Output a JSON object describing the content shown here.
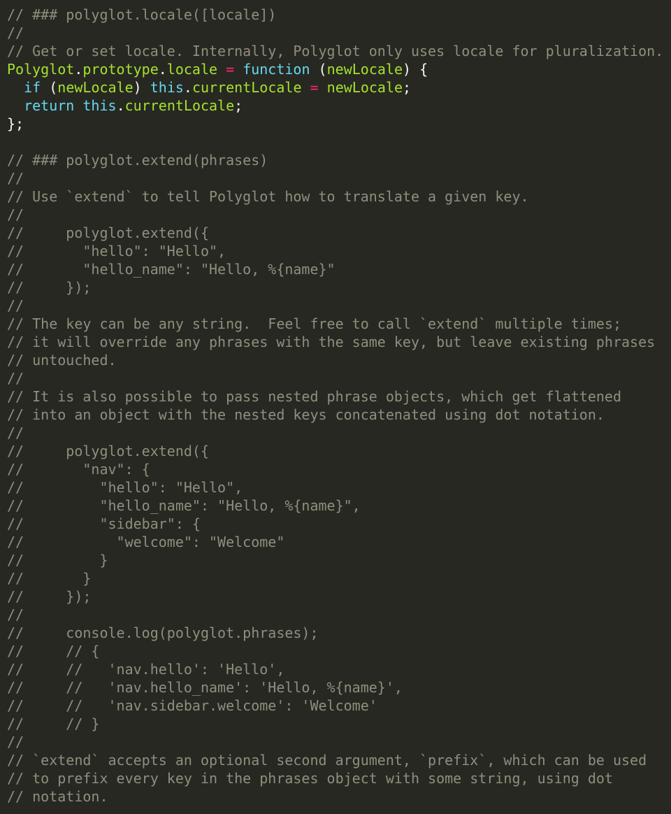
{
  "editor": {
    "language": "javascript",
    "theme_colors": {
      "background": "#272822",
      "comment": "#908e7d",
      "plain": "#f8f8f2",
      "name": "#a6e22e",
      "keyword": "#66d9ef",
      "operator": "#f92672"
    },
    "lines": [
      [
        {
          "t": "comment",
          "v": "// ### polyglot.locale([locale])"
        }
      ],
      [
        {
          "t": "comment",
          "v": "//"
        }
      ],
      [
        {
          "t": "comment",
          "v": "// Get or set locale. Internally, Polyglot only uses locale for pluralization."
        }
      ],
      [
        {
          "t": "name",
          "v": "Polyglot"
        },
        {
          "t": "plain",
          "v": "."
        },
        {
          "t": "name",
          "v": "prototype"
        },
        {
          "t": "plain",
          "v": "."
        },
        {
          "t": "name",
          "v": "locale"
        },
        {
          "t": "plain",
          "v": " "
        },
        {
          "t": "op",
          "v": "="
        },
        {
          "t": "plain",
          "v": " "
        },
        {
          "t": "kw",
          "v": "function"
        },
        {
          "t": "plain",
          "v": " ("
        },
        {
          "t": "name",
          "v": "newLocale"
        },
        {
          "t": "plain",
          "v": ") {"
        }
      ],
      [
        {
          "t": "plain",
          "v": "  "
        },
        {
          "t": "kw",
          "v": "if"
        },
        {
          "t": "plain",
          "v": " ("
        },
        {
          "t": "name",
          "v": "newLocale"
        },
        {
          "t": "plain",
          "v": ") "
        },
        {
          "t": "kw",
          "v": "this"
        },
        {
          "t": "plain",
          "v": "."
        },
        {
          "t": "name",
          "v": "currentLocale"
        },
        {
          "t": "plain",
          "v": " "
        },
        {
          "t": "op",
          "v": "="
        },
        {
          "t": "plain",
          "v": " "
        },
        {
          "t": "name",
          "v": "newLocale"
        },
        {
          "t": "plain",
          "v": ";"
        }
      ],
      [
        {
          "t": "plain",
          "v": "  "
        },
        {
          "t": "kw",
          "v": "return"
        },
        {
          "t": "plain",
          "v": " "
        },
        {
          "t": "kw",
          "v": "this"
        },
        {
          "t": "plain",
          "v": "."
        },
        {
          "t": "name",
          "v": "currentLocale"
        },
        {
          "t": "plain",
          "v": ";"
        }
      ],
      [
        {
          "t": "plain",
          "v": "};"
        }
      ],
      [
        {
          "t": "plain",
          "v": ""
        }
      ],
      [
        {
          "t": "comment",
          "v": "// ### polyglot.extend(phrases)"
        }
      ],
      [
        {
          "t": "comment",
          "v": "//"
        }
      ],
      [
        {
          "t": "comment",
          "v": "// Use `extend` to tell Polyglot how to translate a given key."
        }
      ],
      [
        {
          "t": "comment",
          "v": "//"
        }
      ],
      [
        {
          "t": "comment",
          "v": "//     polyglot.extend({"
        }
      ],
      [
        {
          "t": "comment",
          "v": "//       \"hello\": \"Hello\","
        }
      ],
      [
        {
          "t": "comment",
          "v": "//       \"hello_name\": \"Hello, %{name}\""
        }
      ],
      [
        {
          "t": "comment",
          "v": "//     });"
        }
      ],
      [
        {
          "t": "comment",
          "v": "//"
        }
      ],
      [
        {
          "t": "comment",
          "v": "// The key can be any string.  Feel free to call `extend` multiple times;"
        }
      ],
      [
        {
          "t": "comment",
          "v": "// it will override any phrases with the same key, but leave existing phrases"
        }
      ],
      [
        {
          "t": "comment",
          "v": "// untouched."
        }
      ],
      [
        {
          "t": "comment",
          "v": "//"
        }
      ],
      [
        {
          "t": "comment",
          "v": "// It is also possible to pass nested phrase objects, which get flattened"
        }
      ],
      [
        {
          "t": "comment",
          "v": "// into an object with the nested keys concatenated using dot notation."
        }
      ],
      [
        {
          "t": "comment",
          "v": "//"
        }
      ],
      [
        {
          "t": "comment",
          "v": "//     polyglot.extend({"
        }
      ],
      [
        {
          "t": "comment",
          "v": "//       \"nav\": {"
        }
      ],
      [
        {
          "t": "comment",
          "v": "//         \"hello\": \"Hello\","
        }
      ],
      [
        {
          "t": "comment",
          "v": "//         \"hello_name\": \"Hello, %{name}\","
        }
      ],
      [
        {
          "t": "comment",
          "v": "//         \"sidebar\": {"
        }
      ],
      [
        {
          "t": "comment",
          "v": "//           \"welcome\": \"Welcome\""
        }
      ],
      [
        {
          "t": "comment",
          "v": "//         }"
        }
      ],
      [
        {
          "t": "comment",
          "v": "//       }"
        }
      ],
      [
        {
          "t": "comment",
          "v": "//     });"
        }
      ],
      [
        {
          "t": "comment",
          "v": "//"
        }
      ],
      [
        {
          "t": "comment",
          "v": "//     console.log(polyglot.phrases);"
        }
      ],
      [
        {
          "t": "comment",
          "v": "//     // {"
        }
      ],
      [
        {
          "t": "comment",
          "v": "//     //   'nav.hello': 'Hello',"
        }
      ],
      [
        {
          "t": "comment",
          "v": "//     //   'nav.hello_name': 'Hello, %{name}',"
        }
      ],
      [
        {
          "t": "comment",
          "v": "//     //   'nav.sidebar.welcome': 'Welcome'"
        }
      ],
      [
        {
          "t": "comment",
          "v": "//     // }"
        }
      ],
      [
        {
          "t": "comment",
          "v": "//"
        }
      ],
      [
        {
          "t": "comment",
          "v": "// `extend` accepts an optional second argument, `prefix`, which can be used"
        }
      ],
      [
        {
          "t": "comment",
          "v": "// to prefix every key in the phrases object with some string, using dot"
        }
      ],
      [
        {
          "t": "comment",
          "v": "// notation."
        }
      ]
    ]
  }
}
